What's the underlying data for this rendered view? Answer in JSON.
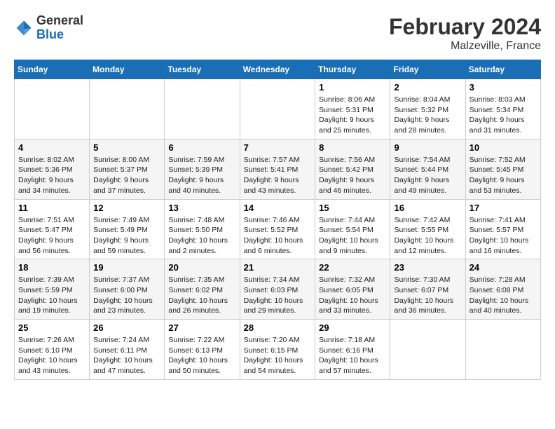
{
  "logo": {
    "general": "General",
    "blue": "Blue"
  },
  "title": "February 2024",
  "subtitle": "Malzeville, France",
  "days_of_week": [
    "Sunday",
    "Monday",
    "Tuesday",
    "Wednesday",
    "Thursday",
    "Friday",
    "Saturday"
  ],
  "weeks": [
    [
      {
        "day": "",
        "info": ""
      },
      {
        "day": "",
        "info": ""
      },
      {
        "day": "",
        "info": ""
      },
      {
        "day": "",
        "info": ""
      },
      {
        "day": "1",
        "info": "Sunrise: 8:06 AM\nSunset: 5:31 PM\nDaylight: 9 hours and 25 minutes."
      },
      {
        "day": "2",
        "info": "Sunrise: 8:04 AM\nSunset: 5:32 PM\nDaylight: 9 hours and 28 minutes."
      },
      {
        "day": "3",
        "info": "Sunrise: 8:03 AM\nSunset: 5:34 PM\nDaylight: 9 hours and 31 minutes."
      }
    ],
    [
      {
        "day": "4",
        "info": "Sunrise: 8:02 AM\nSunset: 5:36 PM\nDaylight: 9 hours and 34 minutes."
      },
      {
        "day": "5",
        "info": "Sunrise: 8:00 AM\nSunset: 5:37 PM\nDaylight: 9 hours and 37 minutes."
      },
      {
        "day": "6",
        "info": "Sunrise: 7:59 AM\nSunset: 5:39 PM\nDaylight: 9 hours and 40 minutes."
      },
      {
        "day": "7",
        "info": "Sunrise: 7:57 AM\nSunset: 5:41 PM\nDaylight: 9 hours and 43 minutes."
      },
      {
        "day": "8",
        "info": "Sunrise: 7:56 AM\nSunset: 5:42 PM\nDaylight: 9 hours and 46 minutes."
      },
      {
        "day": "9",
        "info": "Sunrise: 7:54 AM\nSunset: 5:44 PM\nDaylight: 9 hours and 49 minutes."
      },
      {
        "day": "10",
        "info": "Sunrise: 7:52 AM\nSunset: 5:45 PM\nDaylight: 9 hours and 53 minutes."
      }
    ],
    [
      {
        "day": "11",
        "info": "Sunrise: 7:51 AM\nSunset: 5:47 PM\nDaylight: 9 hours and 56 minutes."
      },
      {
        "day": "12",
        "info": "Sunrise: 7:49 AM\nSunset: 5:49 PM\nDaylight: 9 hours and 59 minutes."
      },
      {
        "day": "13",
        "info": "Sunrise: 7:48 AM\nSunset: 5:50 PM\nDaylight: 10 hours and 2 minutes."
      },
      {
        "day": "14",
        "info": "Sunrise: 7:46 AM\nSunset: 5:52 PM\nDaylight: 10 hours and 6 minutes."
      },
      {
        "day": "15",
        "info": "Sunrise: 7:44 AM\nSunset: 5:54 PM\nDaylight: 10 hours and 9 minutes."
      },
      {
        "day": "16",
        "info": "Sunrise: 7:42 AM\nSunset: 5:55 PM\nDaylight: 10 hours and 12 minutes."
      },
      {
        "day": "17",
        "info": "Sunrise: 7:41 AM\nSunset: 5:57 PM\nDaylight: 10 hours and 16 minutes."
      }
    ],
    [
      {
        "day": "18",
        "info": "Sunrise: 7:39 AM\nSunset: 5:59 PM\nDaylight: 10 hours and 19 minutes."
      },
      {
        "day": "19",
        "info": "Sunrise: 7:37 AM\nSunset: 6:00 PM\nDaylight: 10 hours and 23 minutes."
      },
      {
        "day": "20",
        "info": "Sunrise: 7:35 AM\nSunset: 6:02 PM\nDaylight: 10 hours and 26 minutes."
      },
      {
        "day": "21",
        "info": "Sunrise: 7:34 AM\nSunset: 6:03 PM\nDaylight: 10 hours and 29 minutes."
      },
      {
        "day": "22",
        "info": "Sunrise: 7:32 AM\nSunset: 6:05 PM\nDaylight: 10 hours and 33 minutes."
      },
      {
        "day": "23",
        "info": "Sunrise: 7:30 AM\nSunset: 6:07 PM\nDaylight: 10 hours and 36 minutes."
      },
      {
        "day": "24",
        "info": "Sunrise: 7:28 AM\nSunset: 6:08 PM\nDaylight: 10 hours and 40 minutes."
      }
    ],
    [
      {
        "day": "25",
        "info": "Sunrise: 7:26 AM\nSunset: 6:10 PM\nDaylight: 10 hours and 43 minutes."
      },
      {
        "day": "26",
        "info": "Sunrise: 7:24 AM\nSunset: 6:11 PM\nDaylight: 10 hours and 47 minutes."
      },
      {
        "day": "27",
        "info": "Sunrise: 7:22 AM\nSunset: 6:13 PM\nDaylight: 10 hours and 50 minutes."
      },
      {
        "day": "28",
        "info": "Sunrise: 7:20 AM\nSunset: 6:15 PM\nDaylight: 10 hours and 54 minutes."
      },
      {
        "day": "29",
        "info": "Sunrise: 7:18 AM\nSunset: 6:16 PM\nDaylight: 10 hours and 57 minutes."
      },
      {
        "day": "",
        "info": ""
      },
      {
        "day": "",
        "info": ""
      }
    ]
  ]
}
